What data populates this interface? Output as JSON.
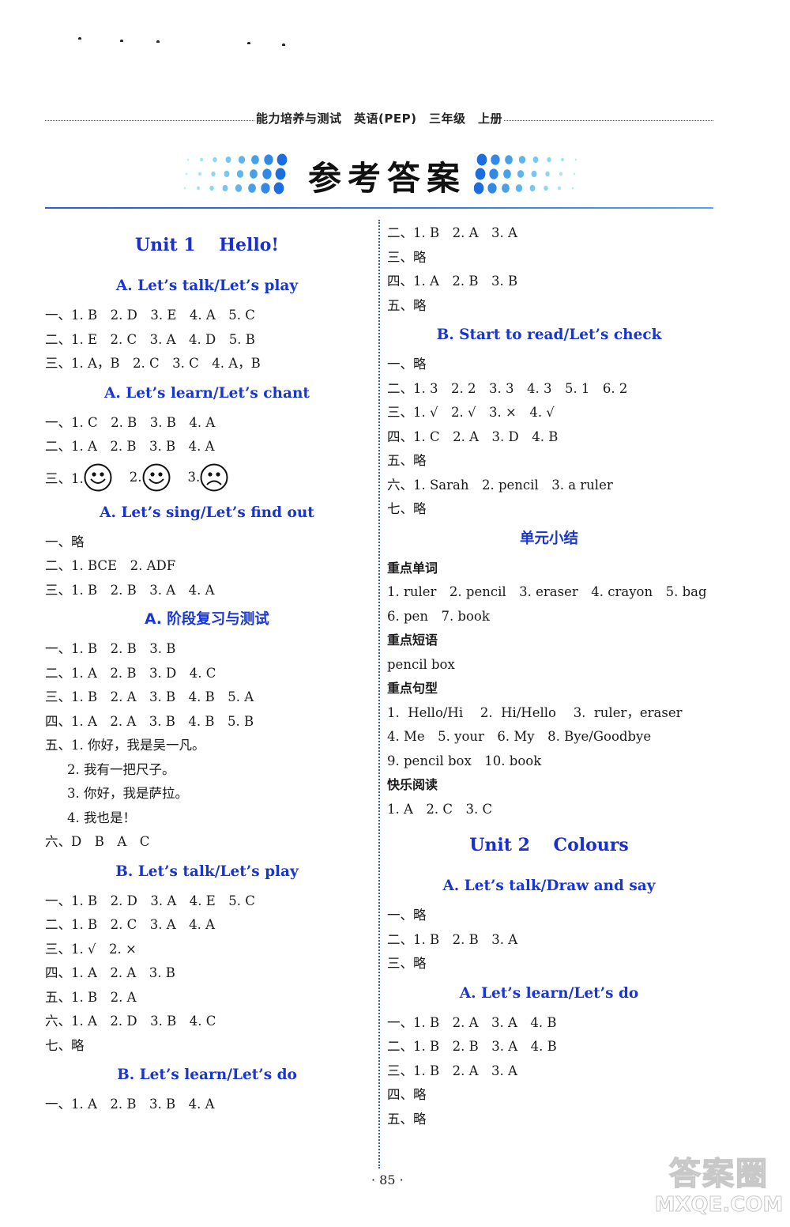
{
  "running_header": {
    "title": "能力培养与测试　英语(PEP)　三年级　上册"
  },
  "banner": {
    "title": "参考答案"
  },
  "colors": {
    "heading_blue": "#1a2fd0",
    "rule_blue": "#2a5fd0",
    "dot_cyan": "#2ad4f0",
    "dot_blue": "#1a6ee0"
  },
  "left_column": {
    "unit1_title": "Unit 1　 Hello!",
    "s1": {
      "title": "A. Let’s talk/Let’s play",
      "lines": [
        "一、1. B　2. D　3. E　4. A　5. C",
        "二、1. E　2. C　3. A　4. D　5. B",
        "三、1. A，B　2. C　3. C　4. A，B"
      ]
    },
    "s2": {
      "title": "A. Let’s learn/Let’s chant",
      "lines": [
        "一、1. C　2. B　3. B　4. A",
        "二、1. A　2. B　3. B　4. A"
      ],
      "smiley_line": {
        "prefix": "三、1.",
        "items": [
          {
            "label": "1.",
            "face": "happy"
          },
          {
            "label": "2.",
            "face": "happy"
          },
          {
            "label": "3.",
            "face": "sad"
          }
        ],
        "label2": "2.",
        "label3": "3."
      }
    },
    "s3": {
      "title": "A. Let’s sing/Let’s find out",
      "lines": [
        "一、略",
        "二、1. BCE　2. ADF",
        "三、1. B　2. B　3. A　4. A"
      ]
    },
    "s4": {
      "title": "A. 阶段复习与测试",
      "lines": [
        "一、1. B　2. B　3. B",
        "二、1. A　2. B　3. D　4. C",
        "三、1. B　2. A　3. B　4. B　5. A",
        "四、1. A　2. A　3. B　4. B　5. B",
        "五、1. 你好，我是吴一凡。"
      ],
      "indented": [
        "2. 我有一把尺子。",
        "3. 你好，我是萨拉。",
        "4. 我也是！"
      ],
      "last": "六、D　B　A　C"
    },
    "s5": {
      "title": "B. Let’s talk/Let’s play",
      "lines": [
        "一、1. B　2. D　3. A　4. E　5. C",
        "二、1. B　2. C　3. A　4. A",
        "三、1. √　2. ×",
        "四、1. A　2. A　3. B",
        "五、1. B　2. A",
        "六、1. A　2. D　3. B　4. C",
        "七、略"
      ]
    },
    "s6": {
      "title": "B. Let’s learn/Let’s do",
      "lines": [
        "一、1. A　2. B　3. B　4. A"
      ]
    }
  },
  "right_column": {
    "s6_cont": {
      "lines": [
        "二、1. B　2. A　3. A",
        "三、略",
        "四、1. A　2. B　3. B",
        "五、略"
      ]
    },
    "s7": {
      "title": "B. Start to read/Let’s check",
      "lines": [
        "一、略",
        "二、1. 3　2. 2　3. 3　4. 3　5. 1　6. 2",
        "三、1. √　2. √　3. ×　4. √",
        "四、1. C　2. A　3. D　4. B",
        "五、略",
        "六、1. Sarah　2. pencil　3. a ruler",
        "七、略"
      ]
    },
    "summary": {
      "title": "单元小结",
      "words_head": "重点单词",
      "words": [
        "1. ruler　2. pencil　3. eraser　4. crayon　5. bag",
        "6. pen　7. book"
      ],
      "phrases_head": "重点短语",
      "phrases": [
        "pencil box"
      ],
      "sentences_head": "重点句型",
      "sentences": [
        "1.  Hello/Hi　 2.  Hi/Hello　 3.  ruler，eraser",
        "4. Me　5. your　6. My　8. Bye/Goodbye",
        "9. pencil box　10. book"
      ],
      "reading_head": "快乐阅读",
      "reading": [
        "1. A　2. C　3. C"
      ]
    },
    "unit2_title": "Unit 2　 Colours",
    "s8": {
      "title": "A. Let’s talk/Draw and say",
      "lines": [
        "一、略",
        "二、1. B　2. B　3. A",
        "三、略"
      ]
    },
    "s9": {
      "title": "A. Let’s learn/Let’s do",
      "lines": [
        "一、1. B　2. A　3. A　4. B",
        "二、1. B　2. B　3. A　4. B",
        "三、1. B　2. A　3. A",
        "四、略",
        "五、略"
      ]
    }
  },
  "footer": {
    "page_number": "· 85 ·"
  },
  "watermark": {
    "cn": "答案圈",
    "en": "MXQE.COM"
  }
}
